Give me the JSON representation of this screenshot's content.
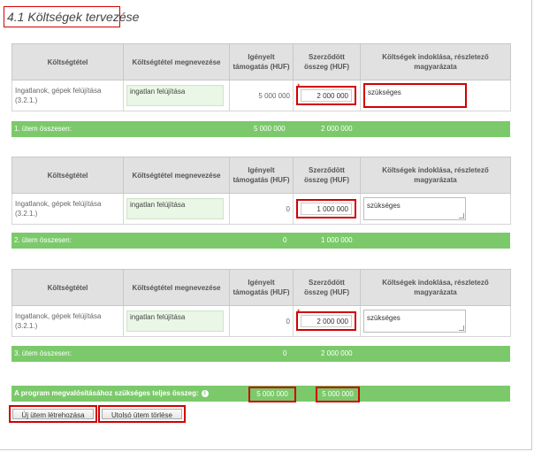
{
  "section_title": "4.1 Költségek tervezése",
  "columns": [
    "Költségtétel",
    "Költségtétel megnevezése",
    "Igényelt támogatás (HUF)",
    "Szerződött összeg (HUF)",
    "Költségek indoklása, részletező magyarázata"
  ],
  "stages": [
    {
      "row": {
        "item": "Ingatlanok, gépek felújítása (3.2.1.)",
        "name": "ingatlan felújítása",
        "requested": "5 000 000",
        "contracted": "2 000 000",
        "reason": "szükséges"
      },
      "summary": {
        "label": "1. ütem összesen:",
        "requested": "5 000 000",
        "contracted": "2 000 000"
      }
    },
    {
      "row": {
        "item": "Ingatlanok, gépek felújítása (3.2.1.)",
        "name": "ingatlan felújítása",
        "requested": "0",
        "contracted": "1 000 000",
        "reason": "szükséges"
      },
      "summary": {
        "label": "2. ütem összesen:",
        "requested": "0",
        "contracted": "1 000 000"
      }
    },
    {
      "row": {
        "item": "Ingatlanok, gépek felújítása (3.2.1.)",
        "name": "ingatlan felújítása",
        "requested": "0",
        "contracted": "2 000 000",
        "reason": "szükséges"
      },
      "summary": {
        "label": "3. ütem összesen:",
        "requested": "0",
        "contracted": "2 000 000"
      }
    }
  ],
  "total": {
    "label": "A program megvalósításához szükséges teljes összeg:",
    "info_icon": "i",
    "requested": "5 000 000",
    "contracted": "5 000 000"
  },
  "buttons": {
    "new_stage": "Új ütem létrehozása",
    "delete_last": "Utolsó ütem törlése"
  },
  "colors": {
    "accent_green": "#7bc96b",
    "highlight_red": "#d20000",
    "header_gray": "#e1e1e1"
  }
}
